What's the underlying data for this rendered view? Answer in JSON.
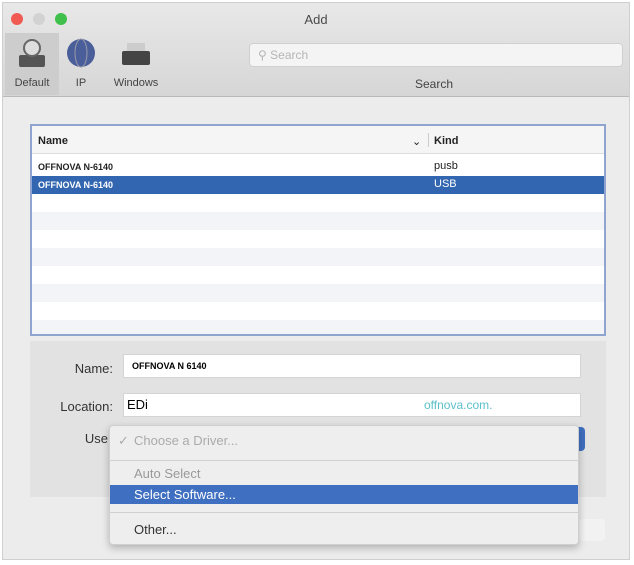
{
  "window": {
    "title": "Add"
  },
  "toolbar": {
    "tools": [
      {
        "label": "Default"
      },
      {
        "label": "IP"
      },
      {
        "label": "Windows"
      }
    ],
    "search_placeholder": "Search",
    "search_label": "Search"
  },
  "table": {
    "headers": {
      "name": "Name",
      "kind": "Kind"
    },
    "rows": [
      {
        "name": "OFFNOVA N-6140",
        "kind": "pusb"
      },
      {
        "name": "OFFNOVA N-6140",
        "kind": "USB"
      }
    ]
  },
  "form": {
    "name_label": "Name:",
    "name_value": "OFFNOVA N 6140",
    "location_label": "Location:",
    "location_value": "EDi",
    "watermark": "offnova.com.",
    "use_label": "Use"
  },
  "menu": {
    "items": [
      {
        "label": "Choose a Driver...",
        "checked": "✓"
      },
      {
        "label": "Auto Select"
      },
      {
        "label": "Select Software..."
      },
      {
        "label": "Other..."
      }
    ]
  },
  "colors": {
    "selection": "#3366b0",
    "watermark": "#5cc0c8"
  }
}
